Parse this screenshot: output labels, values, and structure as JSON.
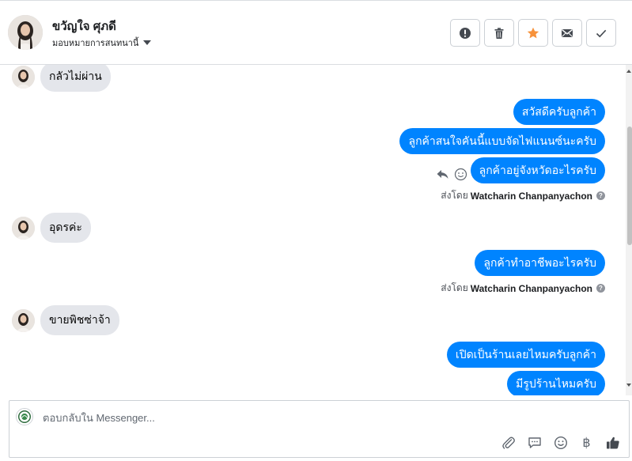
{
  "header": {
    "contact_name": "ขวัญใจ ศุภดี",
    "assign_label": "มอบหมายการสนทนานี้",
    "actions": [
      {
        "icon": "alert-icon",
        "name": "mark-spam-button"
      },
      {
        "icon": "trash-icon",
        "name": "delete-button"
      },
      {
        "icon": "star-icon",
        "name": "star-button",
        "color": "#f7923b"
      },
      {
        "icon": "envelope-icon",
        "name": "mark-unread-button"
      },
      {
        "icon": "check-icon",
        "name": "mark-done-button"
      }
    ]
  },
  "messages": {
    "in_1": "กลัวไม่ผ่าน",
    "out_1": "สวัสดีครับลูกค้า",
    "out_2": "ลูกค้าสนใจคันนี้แบบจัดไฟแนนซ์นะครับ",
    "out_3": "ลูกค้าอยู่จังหวัดอะไรครับ",
    "sent_prefix_1": "ส่งโดย",
    "sender_1": "Watcharin Chanpanyachon",
    "in_2": "อุดรค่ะ",
    "out_4": "ลูกค้าทำอาชีพอะไรครับ",
    "sent_prefix_2": "ส่งโดย",
    "sender_2": "Watcharin Chanpanyachon",
    "in_3": "ขายพิชซ่าจ้า",
    "out_5": "เปิดเป็นร้านเลยไหมครับลูกค้า",
    "out_6": "มีรูปร้านไหมครับ"
  },
  "composer": {
    "placeholder": "ตอบกลับใน Messenger...",
    "tools": [
      "paperclip-icon",
      "chat-bubble-icon",
      "smiley-icon",
      "baht-icon",
      "thumbs-up-icon"
    ],
    "baht_symbol": "฿"
  },
  "colors": {
    "outgoing_bubble": "#0084ff",
    "incoming_bubble": "#e4e6eb",
    "star": "#f7923b"
  }
}
